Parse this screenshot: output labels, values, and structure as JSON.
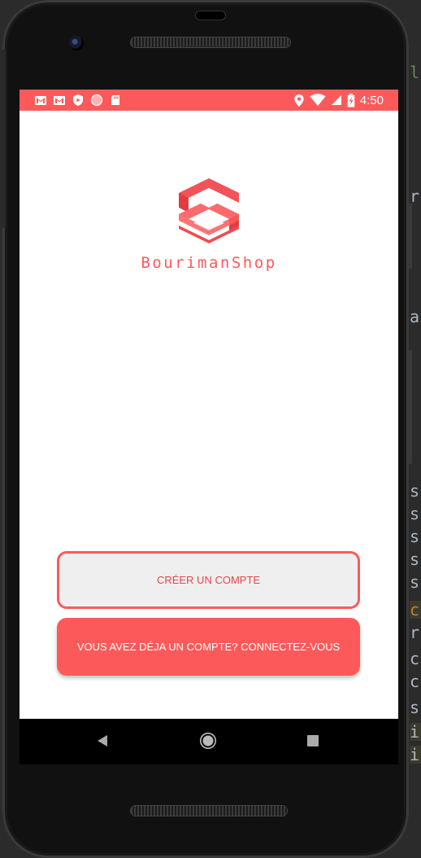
{
  "status_bar": {
    "time": "4:50",
    "left_icons": [
      "gmail-icon",
      "gmail-icon",
      "shield-play-icon",
      "circle-icon",
      "sd-card-icon"
    ],
    "right_icons": [
      "location-icon",
      "wifi-icon",
      "signal-icon",
      "battery-charging-icon"
    ]
  },
  "app": {
    "brand_name": "BourimanShop",
    "primary_color": "#fc5a5a"
  },
  "buttons": {
    "create_account": "CRÉER UN COMPTE",
    "login": "VOUS AVEZ DÉJA UN COMPTE? CONNECTEZ-VOUS"
  },
  "background_ide": {
    "chars": [
      "l",
      "r",
      "a",
      "s",
      "s",
      "s",
      "s",
      "s",
      "c",
      "r",
      "c",
      "c",
      "s",
      "i",
      "i"
    ]
  }
}
